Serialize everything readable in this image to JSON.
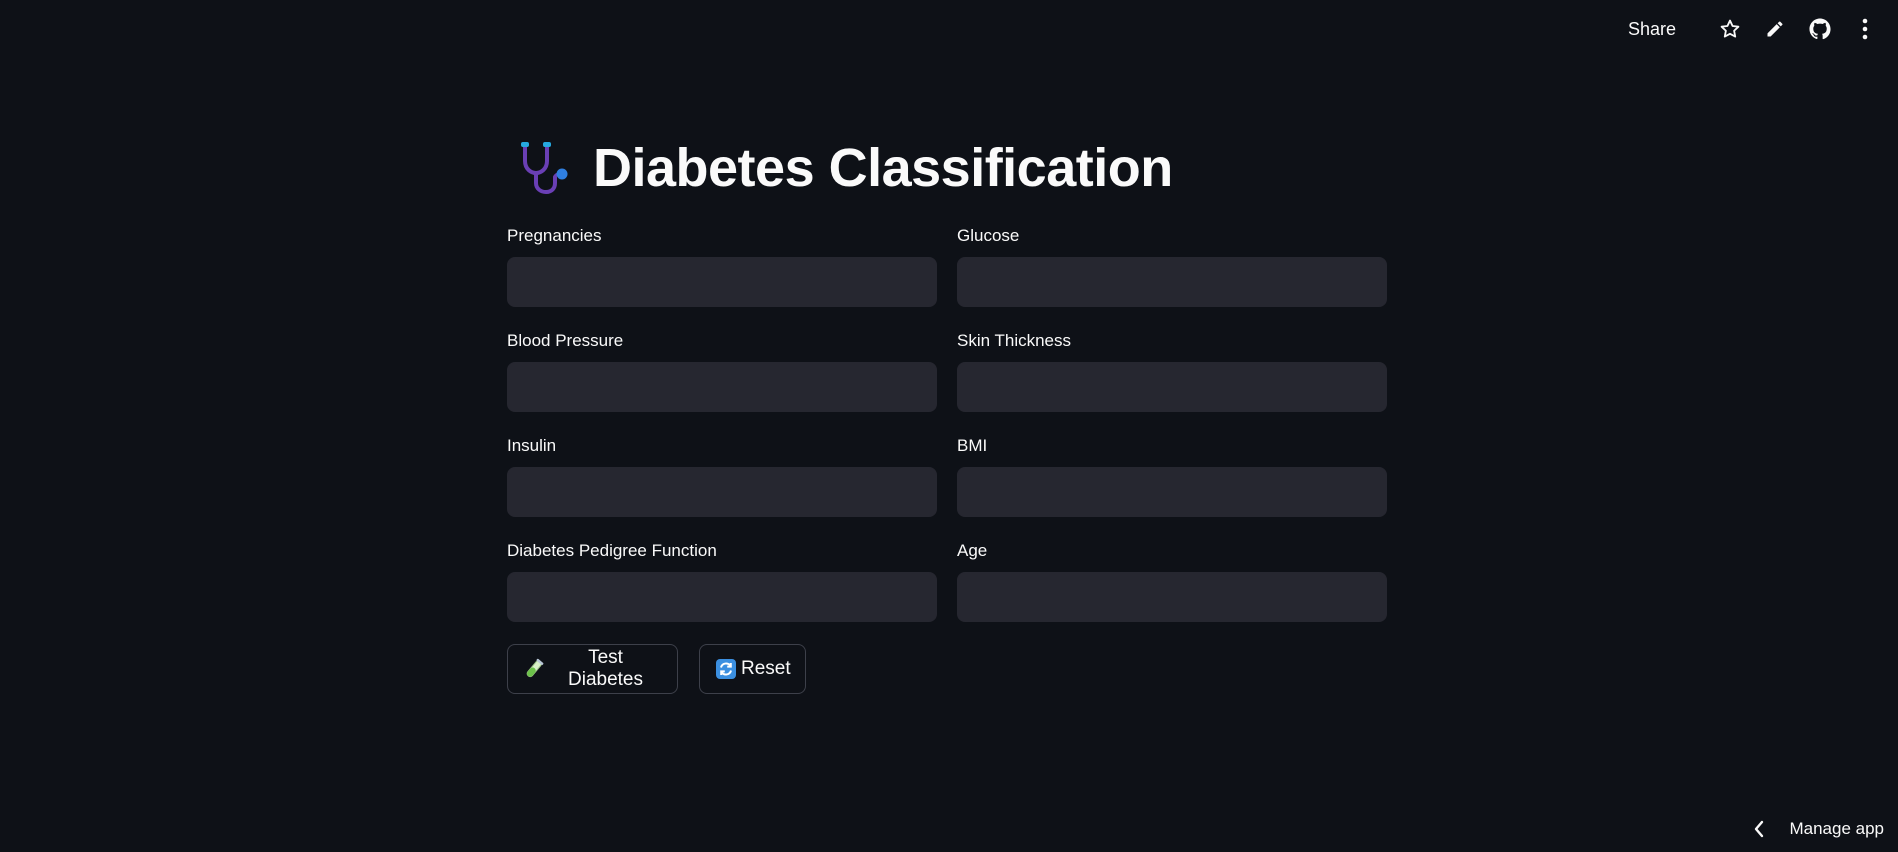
{
  "toolbar": {
    "share_label": "Share",
    "icons": [
      "star-icon",
      "pencil-icon",
      "github-icon",
      "more-vertical-icon"
    ]
  },
  "page": {
    "title": "Diabetes Classification",
    "title_icon": "stethoscope-icon"
  },
  "fields": [
    {
      "label": "Pregnancies",
      "value": "",
      "placeholder": ""
    },
    {
      "label": "Glucose",
      "value": "",
      "placeholder": ""
    },
    {
      "label": "Blood Pressure",
      "value": "",
      "placeholder": ""
    },
    {
      "label": "Skin Thickness",
      "value": "",
      "placeholder": ""
    },
    {
      "label": "Insulin",
      "value": "",
      "placeholder": ""
    },
    {
      "label": "BMI",
      "value": "",
      "placeholder": ""
    },
    {
      "label": "Diabetes Pedigree Function",
      "value": "",
      "placeholder": ""
    },
    {
      "label": "Age",
      "value": "",
      "placeholder": ""
    }
  ],
  "buttons": {
    "test": {
      "label": "Test Diabetes",
      "icon": "test-tube-icon"
    },
    "reset": {
      "label": "Reset",
      "icon": "refresh-icon"
    }
  },
  "footer": {
    "manage_label": "Manage app",
    "manage_icon": "chevron-left-icon"
  },
  "colors": {
    "background": "#0e1117",
    "input_background": "#262730",
    "text": "#fafafa",
    "button_border": "#3d404a"
  }
}
